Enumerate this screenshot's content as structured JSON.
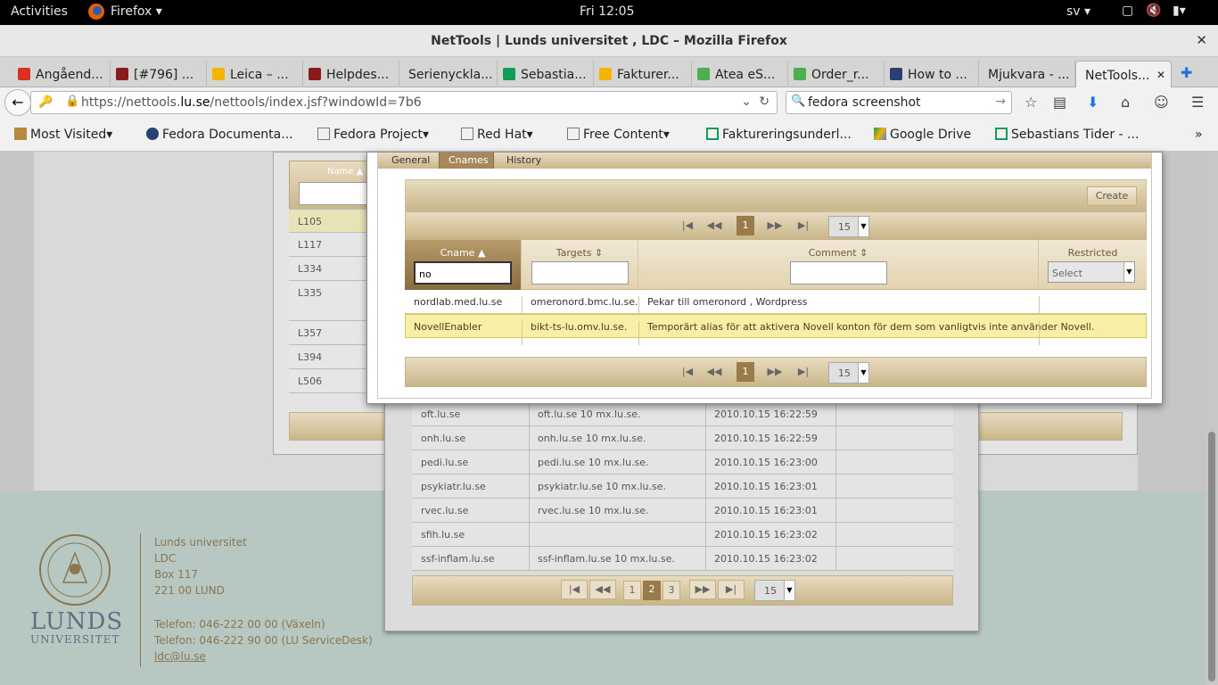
{
  "gnome": {
    "activities": "Activities",
    "app": "Firefox",
    "clock": "Fri 12:05",
    "lang": "sv"
  },
  "window": {
    "title": "NetTools | Lunds universitet , LDC – Mozilla Firefox"
  },
  "tabs": [
    {
      "label": "Angåend...",
      "color": "#d93025"
    },
    {
      "label": "[#796] ...",
      "color": "#8b1a1a"
    },
    {
      "label": "Leica – ...",
      "color": "#f4b400"
    },
    {
      "label": "Helpdes...",
      "color": "#8b1a1a"
    },
    {
      "label": "Serienyckla...",
      "color": ""
    },
    {
      "label": "Sebastia...",
      "color": "#0f9d58"
    },
    {
      "label": "Fakturer...",
      "color": "#f4b400"
    },
    {
      "label": "Atea eS...",
      "color": "#4caf50"
    },
    {
      "label": "Order_r...",
      "color": "#4caf50"
    },
    {
      "label": "How to ...",
      "color": "#294172"
    },
    {
      "label": "Mjukvara - ...",
      "color": ""
    },
    {
      "label": "NetTools...",
      "color": ""
    }
  ],
  "nav": {
    "url_prefix": "https://nettools.",
    "url_domain": "lu.se",
    "url_rest": "/nettools/index.jsf?windowId=7b6",
    "search_value": "fedora screenshot"
  },
  "bookmarks": [
    {
      "label": "Most Visited"
    },
    {
      "label": "Fedora Documenta..."
    },
    {
      "label": "Fedora Project"
    },
    {
      "label": "Red Hat"
    },
    {
      "label": "Free Content"
    },
    {
      "label": "Faktureringsunderl..."
    },
    {
      "label": "Google Drive"
    },
    {
      "label": "Sebastians Tider - ..."
    }
  ],
  "bg_list": {
    "header": "Name",
    "rows": [
      "L105",
      "L117",
      "L334",
      "L335",
      "L357",
      "L394",
      "L506"
    ]
  },
  "mx_table": {
    "rows": [
      {
        "name": "oft.lu.se",
        "target": "oft.lu.se 10 mx.lu.se.",
        "date": "2010.10.15 16:22:59"
      },
      {
        "name": "onh.lu.se",
        "target": "onh.lu.se 10 mx.lu.se.",
        "date": "2010.10.15 16:22:59"
      },
      {
        "name": "pedi.lu.se",
        "target": "pedi.lu.se 10 mx.lu.se.",
        "date": "2010.10.15 16:23:00"
      },
      {
        "name": "psykiatr.lu.se",
        "target": "psykiatr.lu.se 10 mx.lu.se.",
        "date": "2010.10.15 16:23:01"
      },
      {
        "name": "rvec.lu.se",
        "target": "rvec.lu.se 10 mx.lu.se.",
        "date": "2010.10.15 16:23:01"
      },
      {
        "name": "sfih.lu.se",
        "target": "",
        "date": "2010.10.15 16:23:02"
      },
      {
        "name": "ssf-inflam.lu.se",
        "target": "ssf-inflam.lu.se 10 mx.lu.se.",
        "date": "2010.10.15 16:23:02"
      }
    ],
    "pages": [
      "1",
      "2",
      "3"
    ],
    "page_size": "15"
  },
  "modal": {
    "tabs": [
      "General",
      "Cnames",
      "History"
    ],
    "create_label": "Create",
    "page": "1",
    "page_size": "15",
    "columns": [
      "Cname",
      "Targets",
      "Comment",
      "Restricted"
    ],
    "cname_filter": "no",
    "restricted_select": "Select",
    "rows": [
      {
        "cname": "nordlab.med.lu.se",
        "target": "omeronord.bmc.lu.se.",
        "comment": "Pekar till omeronord , Wordpress"
      },
      {
        "cname": "NovellEnabler",
        "target": "bikt-ts-lu.omv.lu.se.",
        "comment": "Temporärt alias för att aktivera Novell konton för dem som vanligtvis inte använder Novell."
      }
    ]
  },
  "footer": {
    "lines": [
      "Lunds universitet",
      "LDC",
      "Box 117",
      "221 00 LUND"
    ],
    "phone1": "Telefon: 046-222 00 00 (Växeln)",
    "phone2": "Telefon: 046-222 90 00 (LU ServiceDesk)",
    "email": "ldc@lu.se",
    "logo_text1": "LUNDS",
    "logo_text2": "UNIVERSITET"
  }
}
